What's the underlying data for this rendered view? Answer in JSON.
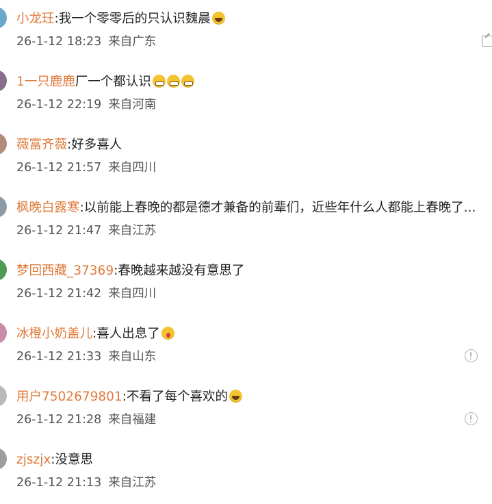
{
  "comments": [
    {
      "username": "小龙玨",
      "text": "我一个零零后的只认识魏晨",
      "emojis": [
        "laugh-emoji"
      ],
      "date": "26-1-12 18:23",
      "location": "来自广东",
      "avatar_color": "#6aa7c9",
      "icon": "share-icon"
    },
    {
      "username": "1一只鹿鹿",
      "text": "厂一个都认识",
      "emojis": [
        "grin-emoji",
        "grin-emoji",
        "grin-emoji"
      ],
      "date": "26-1-12 22:19",
      "location": "来自河南",
      "avatar_color": "#8a6e8f"
    },
    {
      "username": "薇富齐薇",
      "text": "好多喜人",
      "emojis": [],
      "date": "26-1-12 21:57",
      "location": "来自四川",
      "avatar_color": "#b48a78"
    },
    {
      "username": "枫晚白露寒",
      "text": "以前能上春晚的都是德才兼备的前辈们，近些年什么人都能上春晚了...",
      "emojis": [],
      "date": "26-1-12 21:47",
      "location": "来自江苏",
      "avatar_color": "#8c9aa5"
    },
    {
      "username": "梦回西藏_37369",
      "text": "春晚越来越没有意思了",
      "emojis": [],
      "date": "26-1-12 21:42",
      "location": "来自四川",
      "avatar_color": "#4f9a55"
    },
    {
      "username": "冰橙小奶盖儿",
      "text": "喜人出息了",
      "emojis": [
        "wow-emoji"
      ],
      "date": "26-1-12 21:33",
      "location": "来自山东",
      "avatar_color": "#c98ca8",
      "icon": "flag-icon"
    },
    {
      "username": "用户7502679801",
      "text": "不看了每个喜欢的",
      "emojis": [
        "laugh-emoji"
      ],
      "date": "26-1-12 21:28",
      "location": "来自福建",
      "avatar_color": "#b9b9b9",
      "icon": "flag-icon"
    },
    {
      "username": "zjszjx",
      "text": "没意思",
      "emojis": [],
      "date": "26-1-12 21:13",
      "location": "来自江苏",
      "avatar_color": "#9e9e9e"
    }
  ]
}
